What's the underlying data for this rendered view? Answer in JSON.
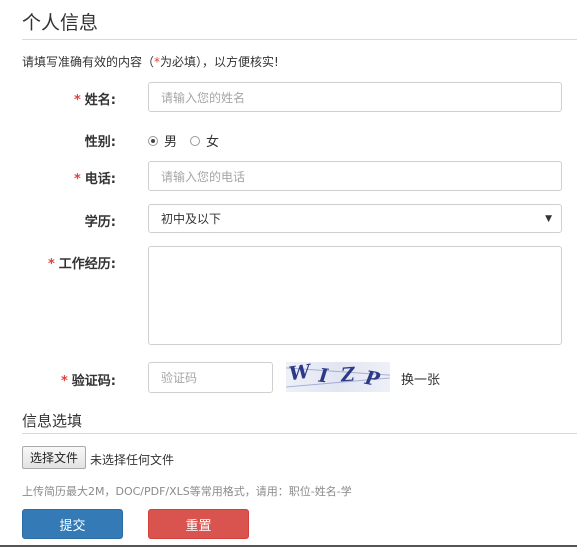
{
  "header": {
    "title": "个人信息"
  },
  "notice": {
    "prefix": "请填写准确有效的内容（",
    "star": "*",
    "suffix": "为必填），以方便核实!"
  },
  "form": {
    "name": {
      "label": "姓名:",
      "required": "*",
      "placeholder": "请输入您的姓名"
    },
    "gender": {
      "label": "性别:",
      "options": [
        "男",
        "女"
      ],
      "selected": "男"
    },
    "phone": {
      "label": "电话:",
      "required": "*",
      "placeholder": "请输入您的电话"
    },
    "education": {
      "label": "学历:",
      "value": "初中及以下"
    },
    "experience": {
      "label": "工作经历:",
      "required": "*",
      "value": ""
    },
    "captcha": {
      "label": "验证码:",
      "required": "*",
      "placeholder": "验证码",
      "code": [
        "W",
        "I",
        "Z",
        "P"
      ],
      "refresh_label": "换一张"
    }
  },
  "section2": {
    "title": "信息选填",
    "file_button": "选择文件",
    "file_status": "未选择任何文件",
    "hint": "上传简历最大2M，DOC/PDF/XLS等常用格式，请用：职位-姓名-学"
  },
  "actions": {
    "submit_label": "提交",
    "reset_label": "重置"
  },
  "colors": {
    "required": "#e0413a",
    "submit": "#337ab7",
    "reset": "#d9534f"
  },
  "icons": {
    "select": "chevron-down-icon",
    "radio": "radio-icon"
  }
}
